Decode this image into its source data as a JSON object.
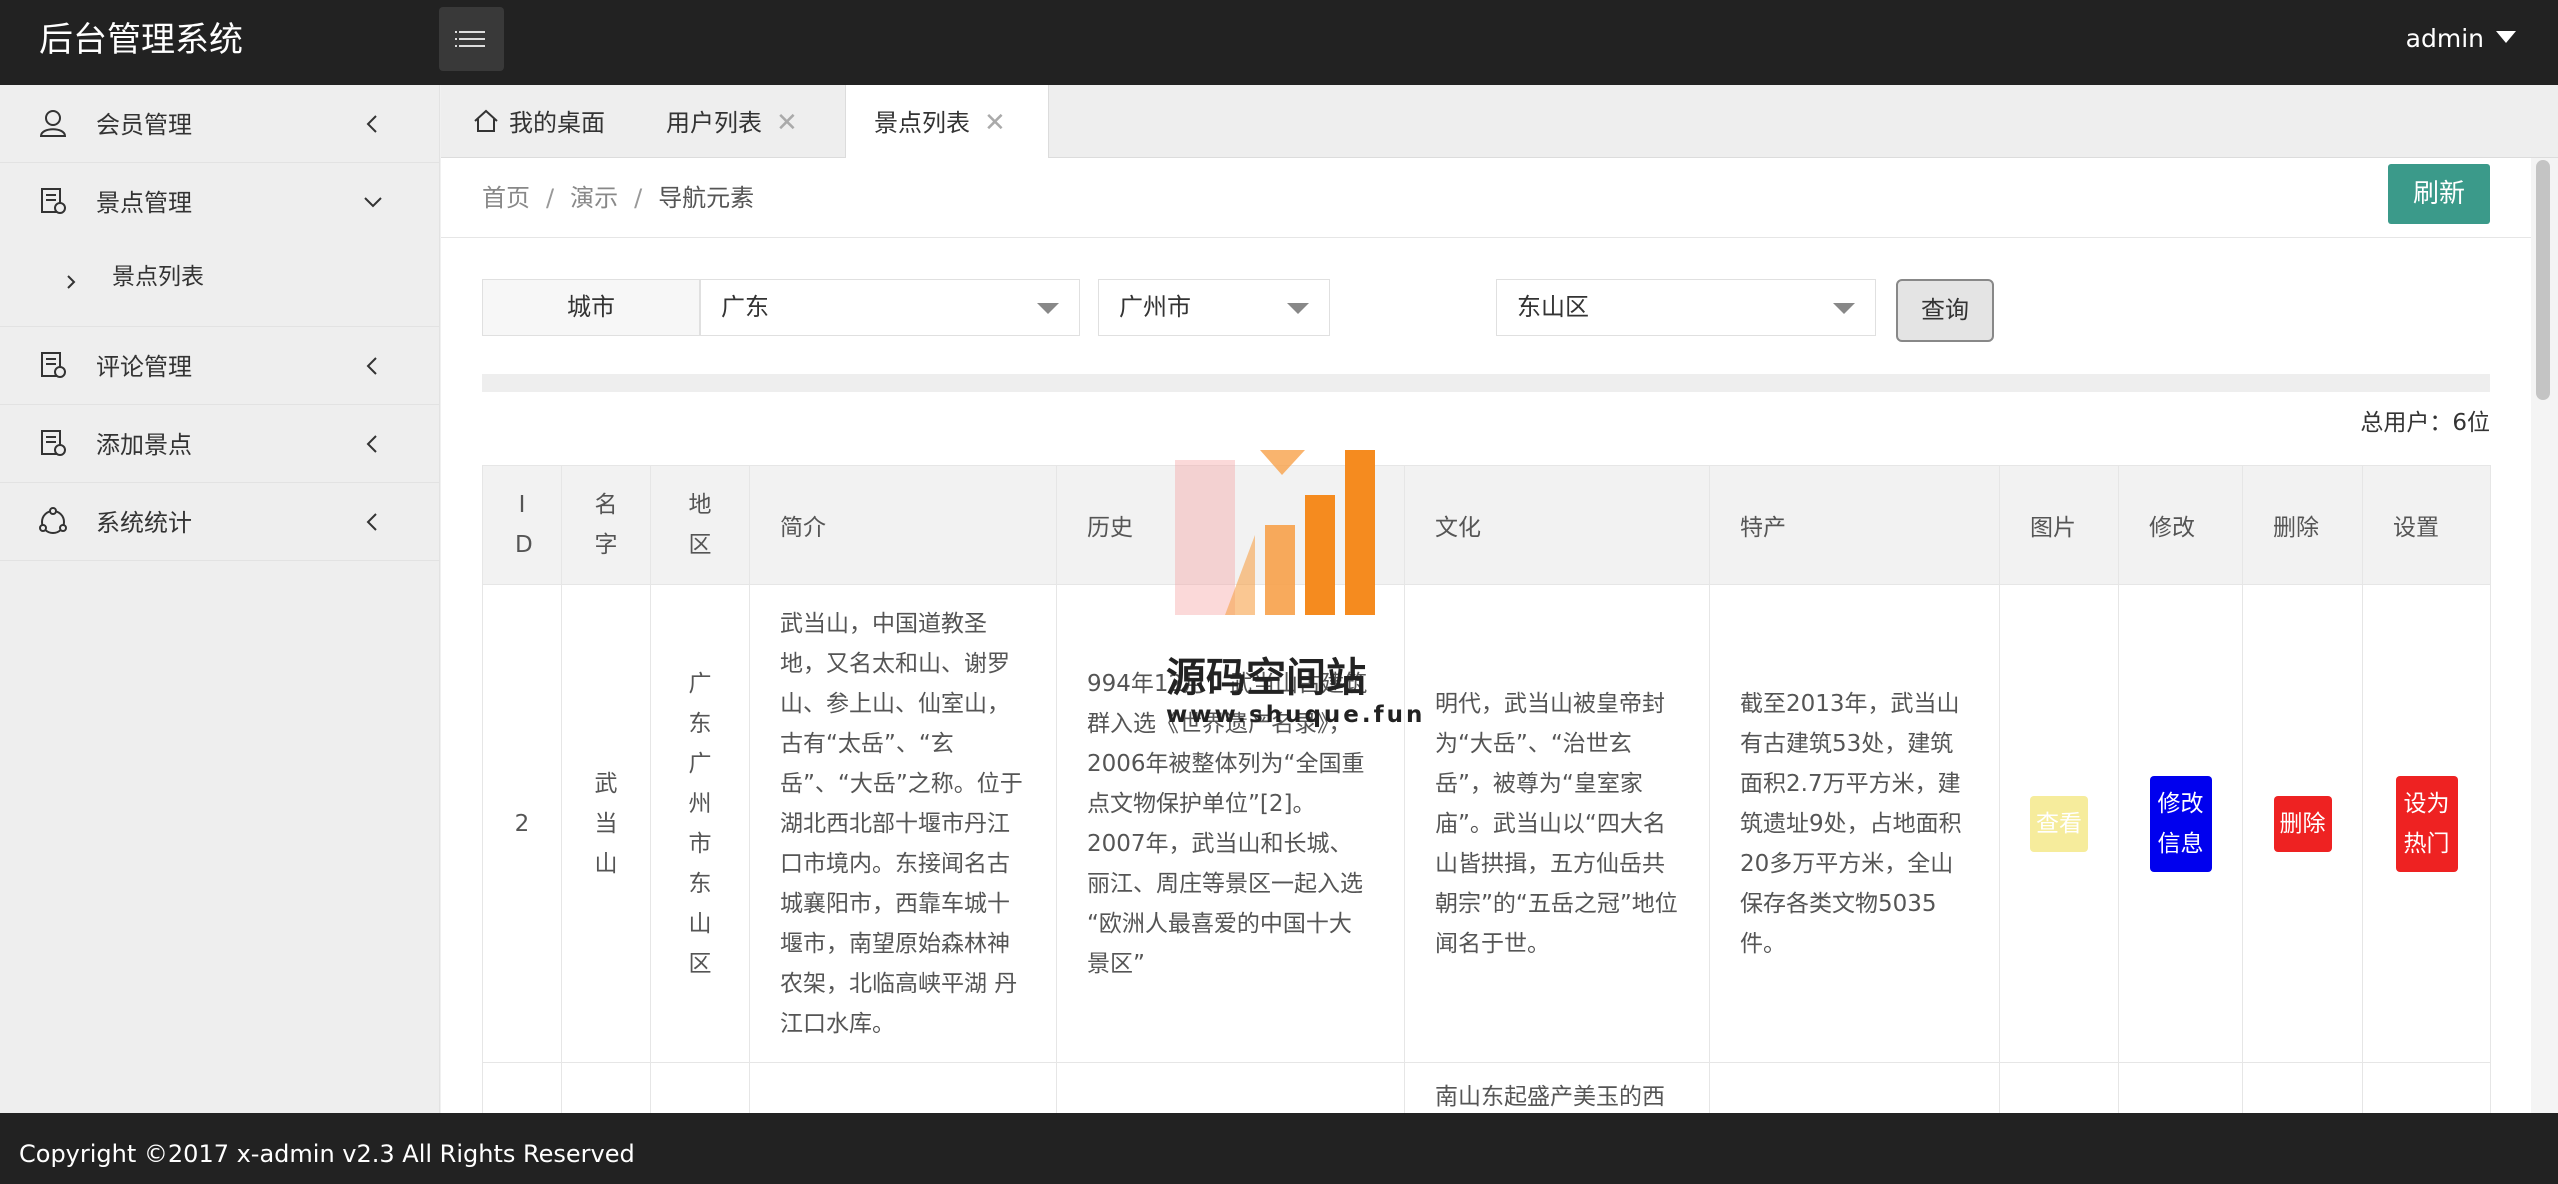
{
  "header": {
    "title": "后台管理系统",
    "user": "admin"
  },
  "sidebar": {
    "items": [
      {
        "label": "会员管理",
        "icon": "user-icon"
      },
      {
        "label": "景点管理",
        "icon": "document-icon"
      },
      {
        "label": "评论管理",
        "icon": "document-icon"
      },
      {
        "label": "添加景点",
        "icon": "document-icon"
      },
      {
        "label": "系统统计",
        "icon": "chart-icon"
      }
    ],
    "sub_item": "景点列表"
  },
  "tabs": [
    {
      "label": "我的桌面"
    },
    {
      "label": "用户列表",
      "close": "✕"
    },
    {
      "label": "景点列表",
      "close": "✕"
    }
  ],
  "breadcrumb": {
    "home": "首页",
    "sep": "/",
    "demo": "演示",
    "current": "导航元素"
  },
  "refresh_label": "刷新",
  "filter": {
    "label": "城市",
    "province": "广东",
    "city": "广州市",
    "district": "东山区",
    "query_label": "查询"
  },
  "total_label": "总用户：6位",
  "table": {
    "headers": {
      "id": "I D",
      "name": "名字",
      "region": "地区",
      "intro": "简介",
      "history": "历史",
      "culture": "文化",
      "specialty": "特产",
      "image": "图片",
      "edit": "修改",
      "delete": "删除",
      "setting": "设置"
    },
    "rows": [
      {
        "id": "2",
        "name": "武当山",
        "region": "广东广州市东山区",
        "intro": "武当山，中国道教圣地，又名太和山、谢罗山、参上山、仙室山，古有“太岳”、“玄岳”、“大岳”之称。位于湖北西北部十堰市丹江口市境内。东接闻名古城襄阳市，西靠车城十堰市，南望原始森林神农架，北临高峡平湖 丹江口水库。",
        "history": "994年12月，武当山古建筑群入选《世界遗产名录》，2006年被整体列为“全国重点文物保护单位”[2]。2007年，武当山和长城、丽江、周庄等景区一起入选 “欧洲人最喜爱的中国十大景区”",
        "culture": "明代，武当山被皇帝封为“大岳”、“治世玄岳”，被尊为“皇室家庙”。武当山以“四大名山皆拱揖，五方仙岳共朝宗”的“五岳之冠”地位闻名于世。",
        "specialty": "截至2013年，武当山有古建筑53处，建筑面积2.7万平方米，建筑遗址9处，占地面积20多万平方米，全山保存各类文物5035件。",
        "view": "查看",
        "edit": "修改信息",
        "delete": "删除",
        "hot": "设为热门"
      },
      {
        "culture": "南山东起盛产美玉的西"
      }
    ]
  },
  "watermark": {
    "title": "源码空间站",
    "url": "www.shuque.fun"
  },
  "footer": "Copyright ©2017 x-admin v2.3 All Rights Reserved",
  "colors": {
    "header": "#222222",
    "refresh": "#3b9a8a",
    "blue_button": "#0000ee",
    "red_button": "#ee2222",
    "yellow_button": "#f6ec9c"
  }
}
